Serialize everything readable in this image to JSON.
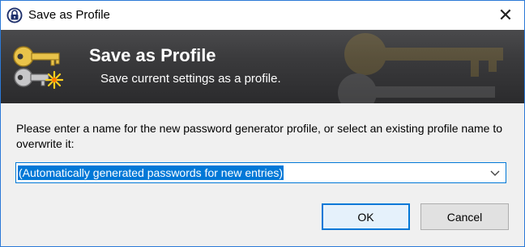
{
  "window": {
    "title": "Save as Profile",
    "close_glyph": "✕"
  },
  "banner": {
    "title": "Save as Profile",
    "subtitle": "Save current settings as a profile.",
    "icon": "keys-with-star-icon"
  },
  "form": {
    "prompt": "Please enter a name for the new password generator profile, or select an existing profile name to overwrite it:",
    "profile_name_value": "(Automatically generated passwords for new entries)"
  },
  "buttons": {
    "ok_label": "OK",
    "cancel_label": "Cancel"
  },
  "colors": {
    "accent": "#0078d7",
    "banner_dark": "#2b2b2d"
  }
}
